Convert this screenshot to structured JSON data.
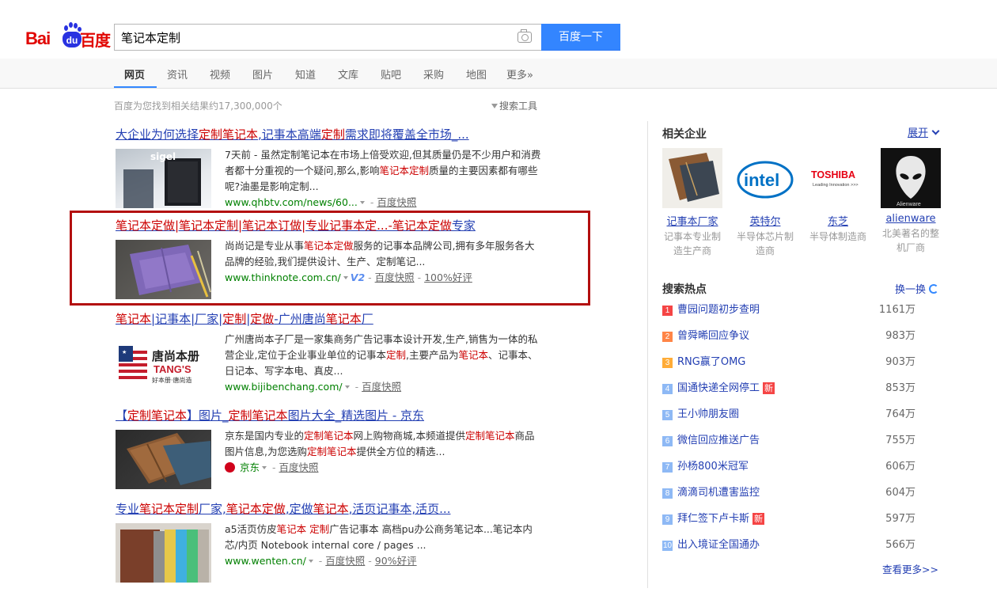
{
  "logo": {
    "latin": "Bai",
    "paw_text": "du",
    "chinese": "百度"
  },
  "search": {
    "query": "笔记本定制",
    "button_label": "百度一下"
  },
  "tabs": [
    {
      "label": "网页",
      "active": true
    },
    {
      "label": "资讯"
    },
    {
      "label": "视频"
    },
    {
      "label": "图片"
    },
    {
      "label": "知道"
    },
    {
      "label": "文库"
    },
    {
      "label": "贴吧"
    },
    {
      "label": "采购"
    },
    {
      "label": "地图"
    },
    {
      "label": "更多»"
    }
  ],
  "stats": "百度为您找到相关结果约17,300,000个",
  "filter_label": "搜索工具",
  "results": [
    {
      "title_parts": [
        "大企业为何选择",
        "定制笔记本",
        ",记事本高端",
        "定制",
        "需求即将覆盖全市场_..."
      ],
      "thumb_text": "sigel",
      "body_parts": [
        "7天前 - 虽然定制笔记本在市场上倍受欢迎,但其质量仍是不少用户和消费者都十分重视的一个疑问,那么,影响",
        "笔记本定制",
        "质量的主要因素都有哪些呢?油墨是影响定制..."
      ],
      "url": "www.qhbtv.com/news/60...",
      "cache": "百度快照"
    },
    {
      "title_parts": [
        "笔记本定做|笔记本定制|笔记本订做|专业记事本定...-笔记本定做",
        "专家"
      ],
      "body_parts": [
        "尚尚记是专业从事",
        "笔记本定做",
        "服务的记事本品牌公司,拥有多年服务各大品牌的经验,我们提供设计、生产、定制笔记..."
      ],
      "url": "www.thinknote.com.cn/",
      "v_badge": "V2",
      "cache": "百度快照",
      "rating": "100%好评"
    },
    {
      "title_parts": [
        "笔记本",
        "|记事本|厂家|",
        "定制",
        "|",
        "定做",
        "-广州唐尚",
        "笔记本",
        "厂"
      ],
      "thumb_text": [
        "唐尚本册",
        "TANG'S",
        "好本册·唐尚造"
      ],
      "body_parts": [
        "广州唐尚本子厂是一家集商务广告记事本设计开发,生产,销售为一体的私营企业,定位于企业事业单位的记事本",
        "定制",
        ",主要产品为",
        "笔记本",
        "、记事本、日记本、写字本电、真皮..."
      ],
      "url": "www.bijibenchang.com/",
      "cache": "百度快照"
    },
    {
      "title_parts": [
        "【",
        "定制笔记本",
        "】图片_",
        "定制笔记本",
        "图片大全_精选图片 - 京东"
      ],
      "body_parts": [
        "京东是国内专业的",
        "定制笔记本",
        "网上购物商城,本频道提供",
        "定制笔记本",
        "商品图片信息,为您选购",
        "定制笔记本",
        "提供全方位的精选..."
      ],
      "url": "京东",
      "cache": "百度快照"
    },
    {
      "title_parts": [
        "专业",
        "笔记本定制",
        "厂家,",
        "笔记本定做",
        ",定做",
        "笔记本",
        ",活页记事本,活页..."
      ],
      "body_parts": [
        "a5活页仿皮",
        "笔记本 定制",
        "广告记事本 高档pu办公商务笔记本...笔记本内芯/内页 Notebook internal core / pages ..."
      ],
      "url": "www.wenten.cn/",
      "cache": "百度快照",
      "rating": "90%好评"
    }
  ],
  "sidebar": {
    "related_title": "相关企业",
    "expand_label": "展开",
    "enterprises": [
      {
        "name": "记事本厂家",
        "desc": "记事本专业制造生产商"
      },
      {
        "name": "英特尔",
        "desc": "半导体芯片制造商",
        "logo_text": "intel"
      },
      {
        "name": "东芝",
        "desc": "半导体制造商",
        "logo_text": "TOSHIBA",
        "logo_sub": "Leading Innovation >>>"
      },
      {
        "name": "alienware",
        "desc": "北美著名的整机厂商",
        "logo_sub": "Alienware"
      }
    ],
    "hot_title": "搜索热点",
    "refresh_label": "换一换",
    "hot_items": [
      {
        "rank": "1",
        "label": "曹园问题初步查明",
        "count": "1161万",
        "color": "#f54545"
      },
      {
        "rank": "2",
        "label": "曾舜晞回应争议",
        "count": "983万",
        "color": "#ff8547"
      },
      {
        "rank": "3",
        "label": "RNG赢了OMG",
        "count": "903万",
        "color": "#ffac38"
      },
      {
        "rank": "4",
        "label": "国通快递全网停工",
        "count": "853万",
        "color": "#8eb9f5",
        "badge": "新"
      },
      {
        "rank": "5",
        "label": "王小帅朋友圈",
        "count": "764万",
        "color": "#8eb9f5"
      },
      {
        "rank": "6",
        "label": "微信回应推送广告",
        "count": "755万",
        "color": "#8eb9f5"
      },
      {
        "rank": "7",
        "label": "孙杨800米冠军",
        "count": "606万",
        "color": "#8eb9f5"
      },
      {
        "rank": "8",
        "label": "滴滴司机遭害监控",
        "count": "604万",
        "color": "#8eb9f5"
      },
      {
        "rank": "9",
        "label": "拜仁签下卢卡斯",
        "count": "597万",
        "color": "#8eb9f5",
        "badge": "新"
      },
      {
        "rank": "10",
        "label": "出入境证全国通办",
        "count": "566万",
        "color": "#8eb9f5"
      }
    ],
    "more_label": "查看更多>>"
  },
  "colors": {
    "brand_red": "#e10602",
    "brand_blue": "#2932e1",
    "button_blue": "#3385ff",
    "link_blue": "#2440b3",
    "highlight_red": "#c00",
    "url_green": "#008000",
    "annotation_red": "#b30f0f"
  }
}
